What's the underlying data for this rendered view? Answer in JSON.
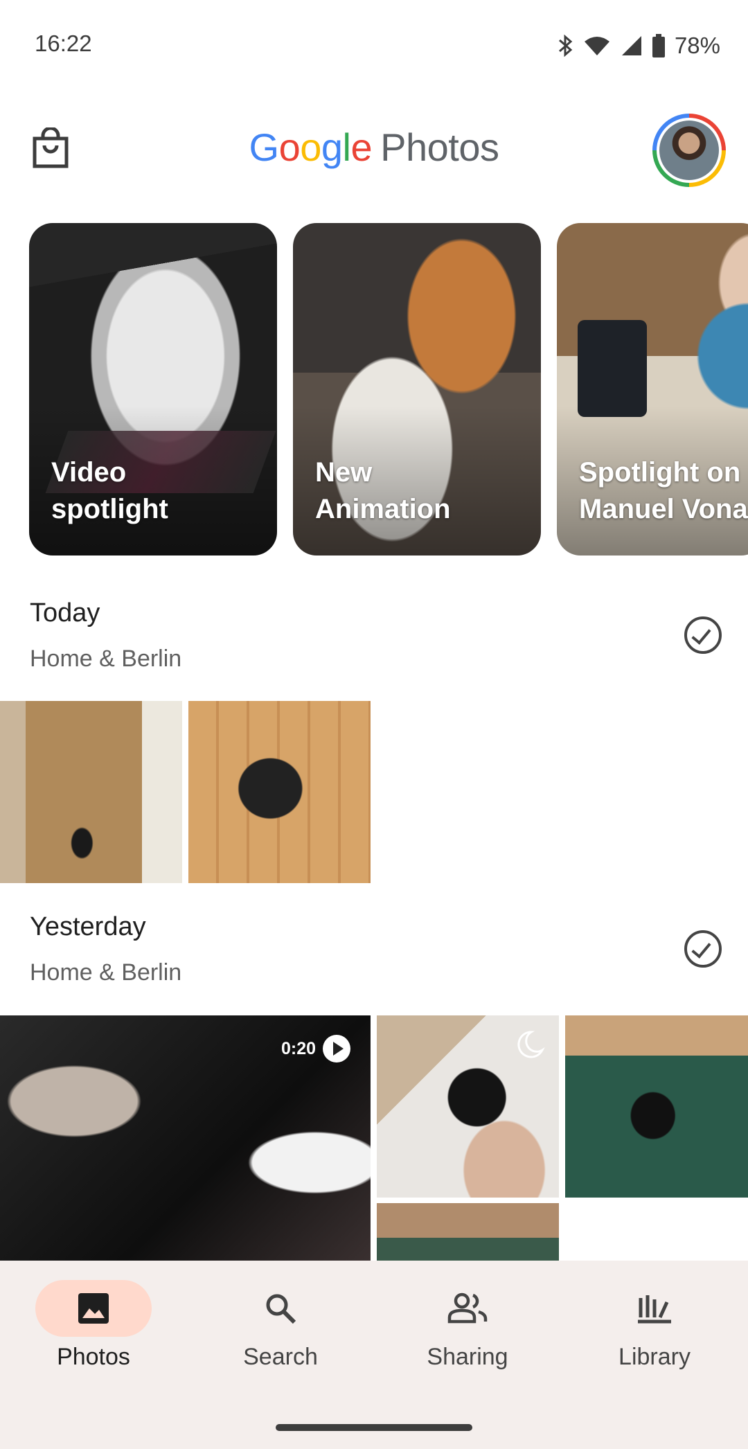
{
  "status_bar": {
    "time": "16:22",
    "battery": "78%"
  },
  "header": {
    "logo_letters": [
      "G",
      "o",
      "o",
      "g",
      "l",
      "e"
    ],
    "logo_suffix": "Photos"
  },
  "memories": [
    {
      "label": "Video\nspotlight"
    },
    {
      "label": "New\nAnimation"
    },
    {
      "label": "Spotlight on\nManuel Vona"
    }
  ],
  "sections": [
    {
      "title": "Today",
      "subtitle": "Home & Berlin"
    },
    {
      "title": "Yesterday",
      "subtitle": "Home & Berlin"
    }
  ],
  "video": {
    "duration": "0:20"
  },
  "nav": {
    "items": [
      {
        "label": "Photos",
        "icon": "photo-icon",
        "active": true
      },
      {
        "label": "Search",
        "icon": "search-icon",
        "active": false
      },
      {
        "label": "Sharing",
        "icon": "people-icon",
        "active": false
      },
      {
        "label": "Library",
        "icon": "library-icon",
        "active": false
      }
    ]
  },
  "colors": {
    "google_blue": "#4285F4",
    "google_red": "#EA4335",
    "google_yellow": "#FBBC05",
    "google_green": "#34A853",
    "nav_active": "#ffd9cc",
    "nav_bg": "#f4eeec"
  }
}
